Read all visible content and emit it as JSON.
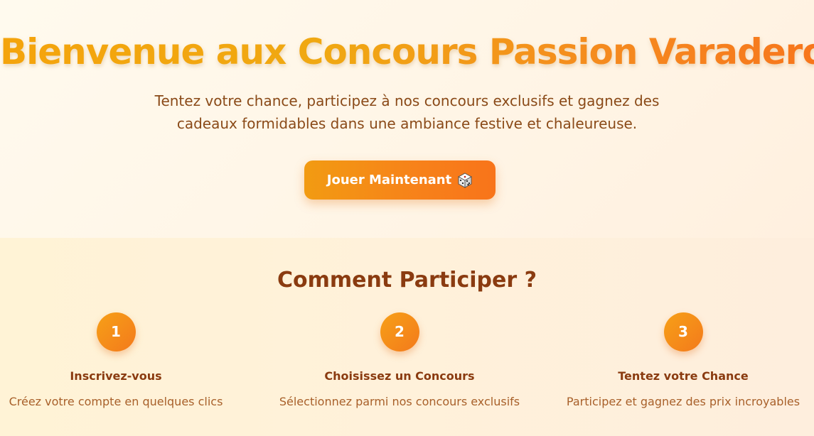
{
  "hero": {
    "title": "Bienvenue aux Concours Passion Varadero",
    "subtitle": "Tentez votre chance, participez à nos concours exclusifs et gagnez des cadeaux formidables dans une ambiance festive et chaleureuse.",
    "cta_label": "Jouer Maintenant",
    "cta_icon": "dice-icon"
  },
  "how": {
    "title": "Comment Participer ?",
    "steps": [
      {
        "number": "1",
        "title": "Inscrivez-vous",
        "description": "Créez votre compte en quelques clics"
      },
      {
        "number": "2",
        "title": "Choisissez un Concours",
        "description": "Sélectionnez parmi nos concours exclusifs"
      },
      {
        "number": "3",
        "title": "Tentez votre Chance",
        "description": "Participez et gagnez des prix incroyables"
      }
    ]
  },
  "colors": {
    "accent_orange": "#f7811a",
    "accent_gold": "#f4a40c",
    "heading_brown": "#8a3b10",
    "text_brown": "#8a4a18"
  }
}
